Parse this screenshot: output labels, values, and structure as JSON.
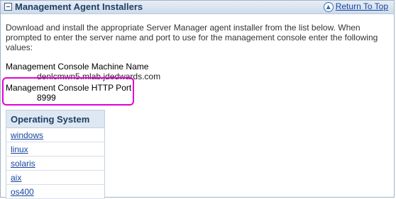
{
  "section": {
    "title": "Management Agent Installers",
    "return_link": "Return To Top",
    "collapse_icon": "minus-icon",
    "return_icon": "up-arrow-icon"
  },
  "intro_text": "Download and install the appropriate Server Manager agent installer from the list below. When prompted to enter the server name and port to use for the management console enter the following values:",
  "console": {
    "machine_label": "Management Console Machine Name",
    "machine_value": "denlcmwn5.mlab.jdedwards.com",
    "port_label": "Management Console HTTP Port",
    "port_value": "8999"
  },
  "os_table": {
    "header": "Operating System",
    "rows": [
      "windows",
      "linux",
      "solaris",
      "aix",
      "os400"
    ]
  },
  "colors": {
    "header_text": "#1f3f63",
    "link": "#1646a0",
    "highlight": "#e400d6"
  }
}
